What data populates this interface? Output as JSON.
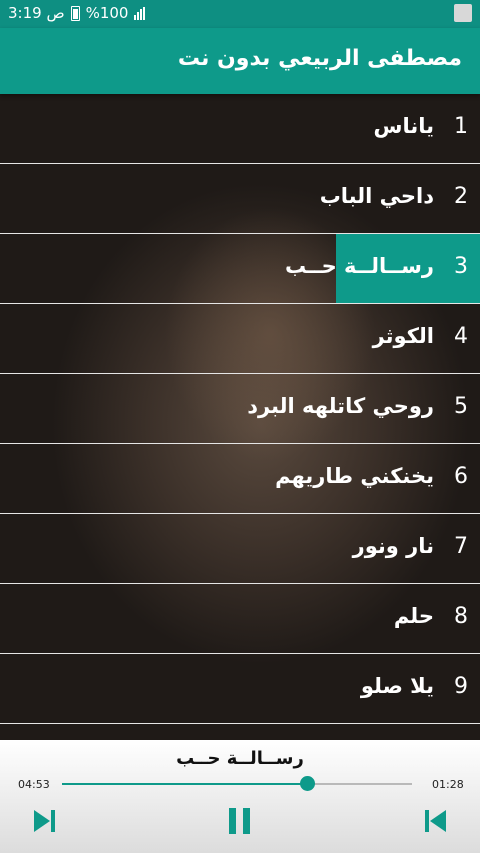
{
  "status_bar": {
    "time": "3:19 ص",
    "battery": "%100"
  },
  "app": {
    "title": "مصطفى الربيعي بدون نت"
  },
  "songs": [
    {
      "num": "1",
      "name": "ياناس"
    },
    {
      "num": "2",
      "name": "داحي الباب"
    },
    {
      "num": "3",
      "name": "رســالــة حــب"
    },
    {
      "num": "4",
      "name": "الكوثر"
    },
    {
      "num": "5",
      "name": "روحي كاتلهه البرد"
    },
    {
      "num": "6",
      "name": "يخنكني طاريهم"
    },
    {
      "num": "7",
      "name": "نار ونور"
    },
    {
      "num": "8",
      "name": "حلم"
    },
    {
      "num": "9",
      "name": "يلا صلو"
    }
  ],
  "active_index": 2,
  "player": {
    "now_playing": "رســالــة حــب",
    "elapsed": "04:53",
    "remaining": "01:28",
    "progress": 0.7
  },
  "colors": {
    "accent": "#0e9a8a",
    "status_bar": "#0e8f82"
  }
}
